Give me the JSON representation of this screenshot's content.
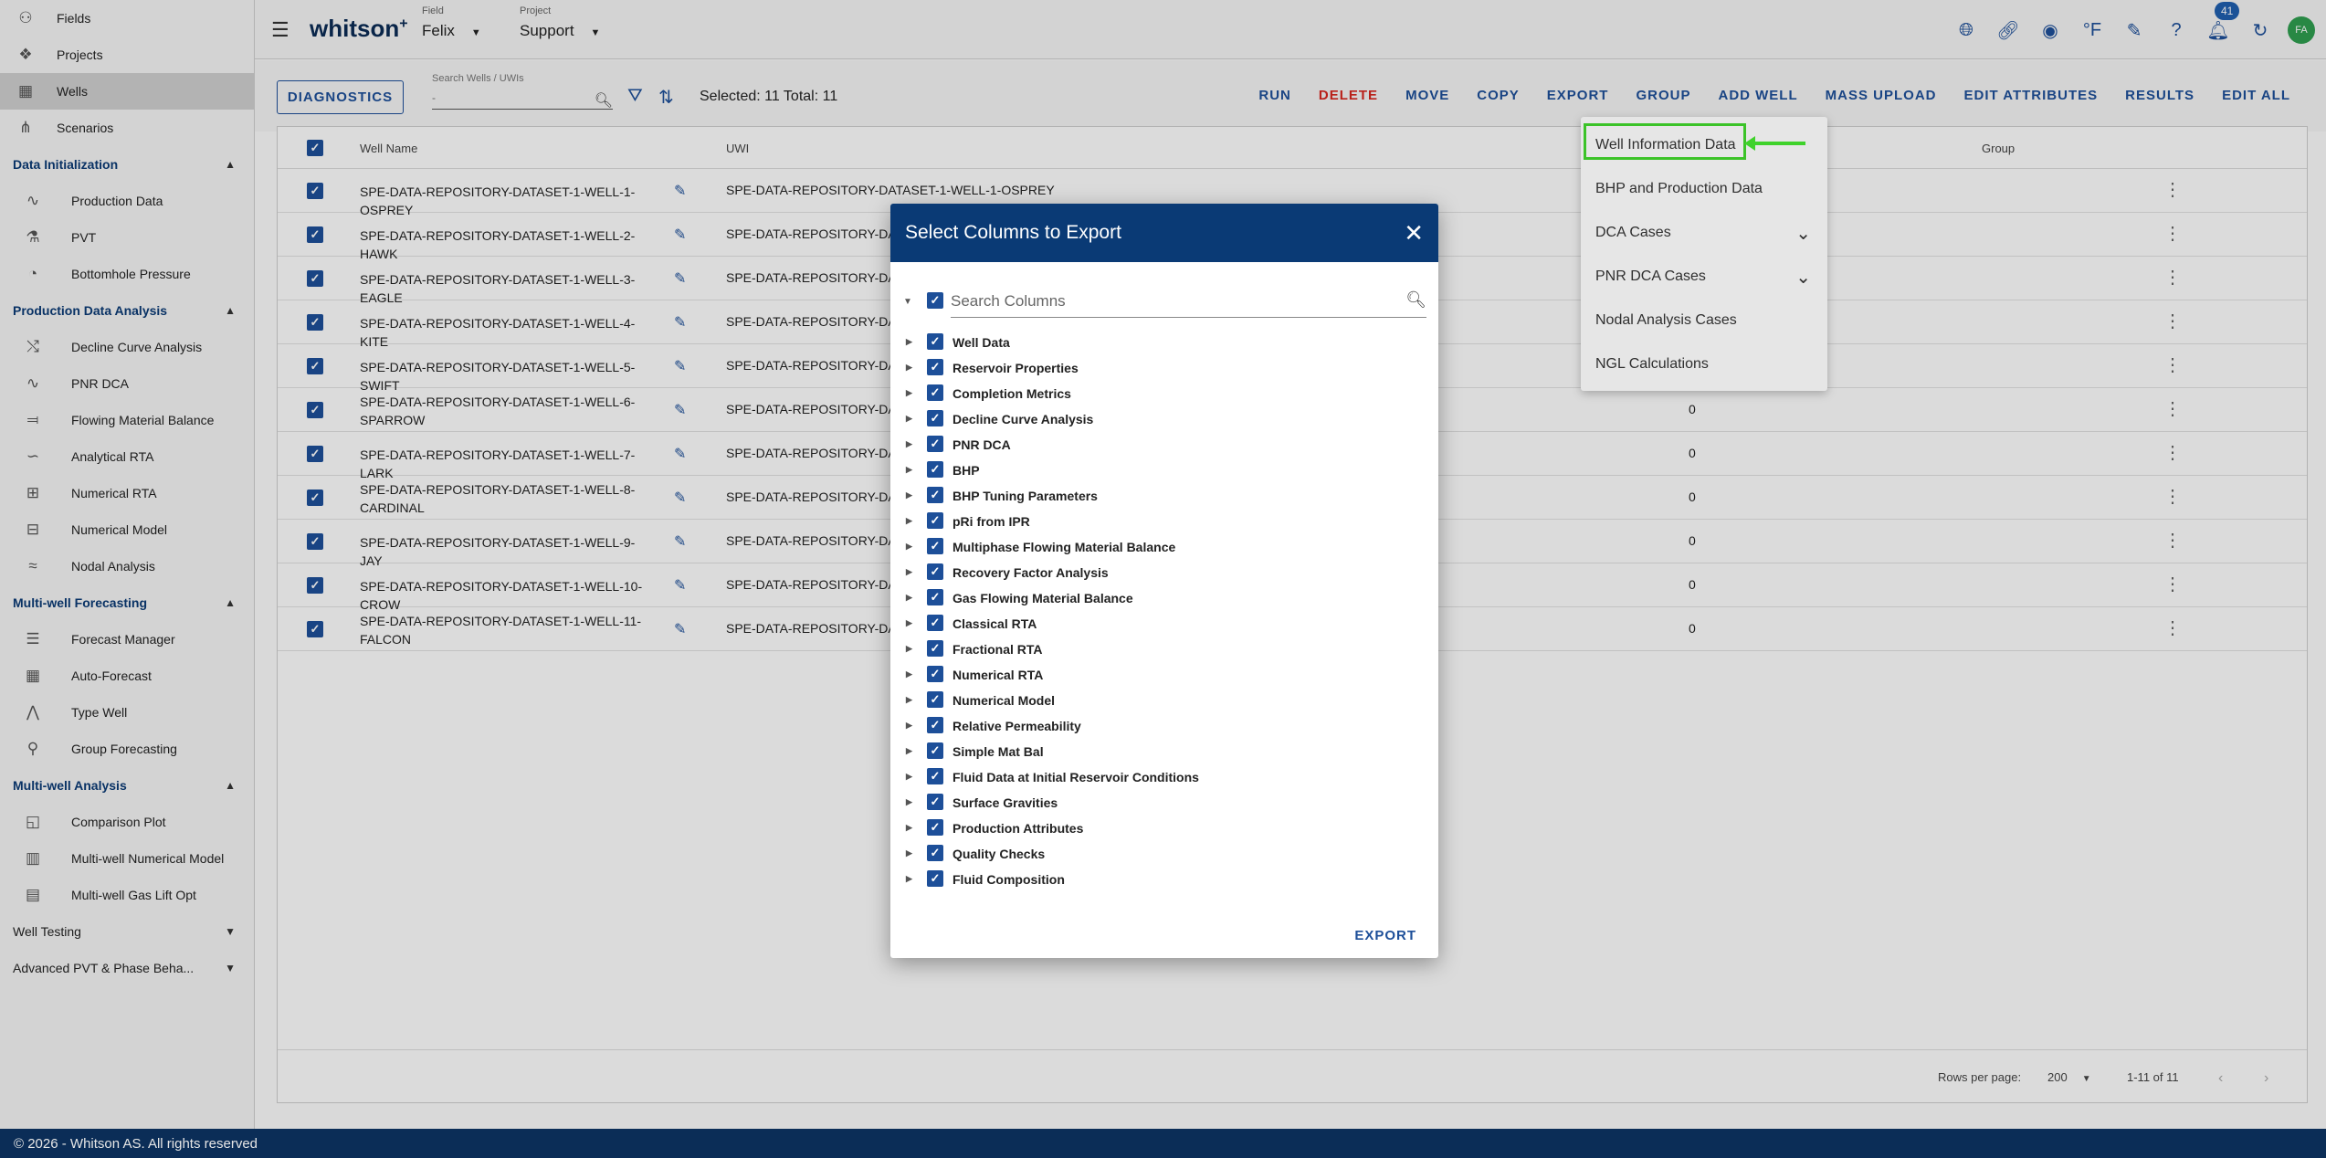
{
  "sidebar": {
    "top_items": [
      {
        "label": "Fields",
        "icon": "fields-icon"
      },
      {
        "label": "Projects",
        "icon": "projects-icon"
      },
      {
        "label": "Wells",
        "icon": "wells-icon"
      },
      {
        "label": "Scenarios",
        "icon": "scenarios-icon"
      }
    ],
    "sections": [
      {
        "title": "Data Initialization",
        "items": [
          "Production Data",
          "PVT",
          "Bottomhole Pressure"
        ]
      },
      {
        "title": "Production Data Analysis",
        "items": [
          "Decline Curve Analysis",
          "PNR DCA",
          "Flowing Material Balance",
          "Analytical RTA",
          "Numerical RTA",
          "Numerical Model",
          "Nodal Analysis"
        ]
      },
      {
        "title": "Multi-well Forecasting",
        "items": [
          "Forecast Manager",
          "Auto-Forecast",
          "Type Well",
          "Group Forecasting"
        ]
      },
      {
        "title": "Multi-well Analysis",
        "items": [
          "Comparison Plot",
          "Multi-well Numerical Model",
          "Multi-well Gas Lift Opt"
        ]
      }
    ],
    "collapsed_sections": [
      "Well Testing",
      "Advanced PVT & Phase Beha..."
    ]
  },
  "header": {
    "logo": "whitson",
    "logo_sup": "+",
    "field_label": "Field",
    "field_value": "Felix",
    "project_label": "Project",
    "project_value": "Support",
    "unit_label": "°F",
    "notification_count": "41",
    "avatar_initials": "FA"
  },
  "toolbar": {
    "diagnostics": "DIAGNOSTICS",
    "search_label": "Search Wells / UWIs",
    "search_value": "-",
    "selection": "Selected: 11 Total: 11",
    "actions": [
      "RUN",
      "DELETE",
      "MOVE",
      "COPY",
      "EXPORT",
      "GROUP",
      "ADD WELL",
      "MASS UPLOAD",
      "EDIT ATTRIBUTES",
      "RESULTS",
      "EDIT ALL"
    ]
  },
  "table": {
    "columns": {
      "well_name": "Well Name",
      "uwi": "UWI",
      "group": "Group"
    },
    "rows": [
      {
        "name": "SPE-DATA-REPOSITORY-DATASET-1-WELL-1-OSPREY",
        "uwi": "SPE-DATA-REPOSITORY-DATASET-1-WELL-1-OSPREY",
        "value": ""
      },
      {
        "name": "SPE-DATA-REPOSITORY-DATASET-1-WELL-2-HAWK",
        "uwi": "SPE-DATA-REPOSITORY-DATA",
        "value": ""
      },
      {
        "name": "SPE-DATA-REPOSITORY-DATASET-1-WELL-3-EAGLE",
        "uwi": "SPE-DATA-REPOSITORY-DATA",
        "value": ""
      },
      {
        "name": "SPE-DATA-REPOSITORY-DATASET-1-WELL-4-KITE",
        "uwi": "SPE-DATA-REPOSITORY-DATA",
        "value": ""
      },
      {
        "name": "SPE-DATA-REPOSITORY-DATASET-1-WELL-5-SWIFT",
        "uwi": "SPE-DATA-REPOSITORY-DATA",
        "value": ""
      },
      {
        "name": "SPE-DATA-REPOSITORY-DATASET-1-WELL-6-SPARROW",
        "uwi": "SPE-DATA-REPOSITORY-DATA",
        "value": "0"
      },
      {
        "name": "SPE-DATA-REPOSITORY-DATASET-1-WELL-7-LARK",
        "uwi": "SPE-DATA-REPOSITORY-DATA",
        "value": "0"
      },
      {
        "name": "SPE-DATA-REPOSITORY-DATASET-1-WELL-8-CARDINAL",
        "uwi": "SPE-DATA-REPOSITORY-DATA",
        "value": "0"
      },
      {
        "name": "SPE-DATA-REPOSITORY-DATASET-1-WELL-9-JAY",
        "uwi": "SPE-DATA-REPOSITORY-DATA",
        "value": "0"
      },
      {
        "name": "SPE-DATA-REPOSITORY-DATASET-1-WELL-10-CROW",
        "uwi": "SPE-DATA-REPOSITORY-DATA",
        "value": "0"
      },
      {
        "name": "SPE-DATA-REPOSITORY-DATASET-1-WELL-11-FALCON",
        "uwi": "SPE-DATA-REPOSITORY-DATA",
        "value": "0"
      }
    ],
    "pager": {
      "rows_label": "Rows per page:",
      "rows_value": "200",
      "range": "1-11 of 11"
    }
  },
  "export_menu": {
    "items": [
      {
        "label": "Well Information Data",
        "expandable": false
      },
      {
        "label": "BHP and Production Data",
        "expandable": false
      },
      {
        "label": "DCA Cases",
        "expandable": true
      },
      {
        "label": "PNR DCA Cases",
        "expandable": true
      },
      {
        "label": "Nodal Analysis Cases",
        "expandable": false
      },
      {
        "label": "NGL Calculations",
        "expandable": false
      }
    ]
  },
  "modal": {
    "title": "Select Columns to Export",
    "search_placeholder": "Search Columns",
    "columns": [
      "Well Data",
      "Reservoir Properties",
      "Completion Metrics",
      "Decline Curve Analysis",
      "PNR DCA",
      "BHP",
      "BHP Tuning Parameters",
      "pRi from IPR",
      "Multiphase Flowing Material Balance",
      "Recovery Factor Analysis",
      "Gas Flowing Material Balance",
      "Classical RTA",
      "Fractional RTA",
      "Numerical RTA",
      "Numerical Model",
      "Relative Permeability",
      "Simple Mat Bal",
      "Fluid Data at Initial Reservoir Conditions",
      "Surface Gravities",
      "Production Attributes",
      "Quality Checks",
      "Fluid Composition"
    ],
    "export_label": "EXPORT"
  },
  "footer": {
    "text": "© 2026 - Whitson AS. All rights reserved"
  },
  "colors": {
    "primary": "#1d4f99",
    "header_dark": "#0a3a75",
    "delete": "#d7261e",
    "highlight": "#3fd22b"
  }
}
